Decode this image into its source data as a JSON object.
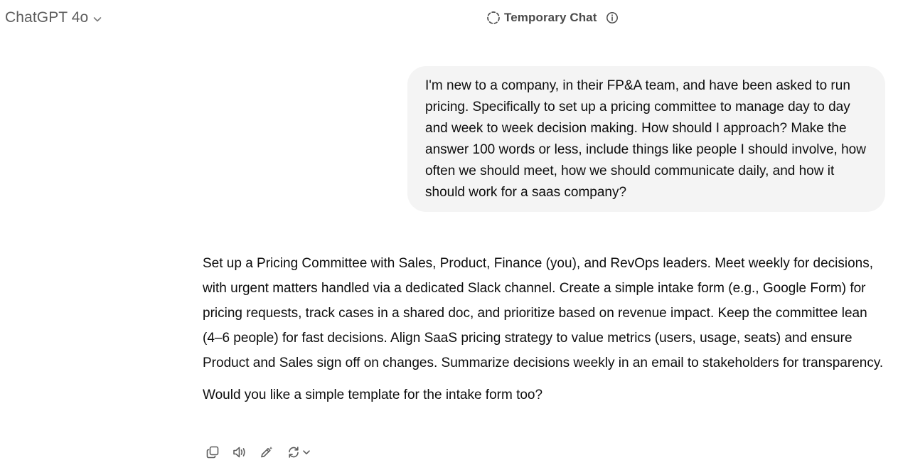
{
  "header": {
    "model_name": "ChatGPT 4o",
    "temporary_chat_label": "Temporary Chat"
  },
  "conversation": {
    "user_message": "I'm new to a company, in their FP&A team, and have been asked to run pricing. Specifically to set up a pricing committee to manage day to day and week to week decision making. How should I approach? Make the answer 100 words or less, include things like people I should involve, how often we should meet, how we should communicate daily, and how it should work for a saas company?",
    "assistant_paragraphs": [
      "Set up a Pricing Committee with Sales, Product, Finance (you), and RevOps leaders. Meet weekly for decisions, with urgent matters handled via a dedicated Slack channel. Create a simple intake form (e.g., Google Form) for pricing requests, track cases in a shared doc, and prioritize based on revenue impact. Keep the committee lean (4–6 people) for fast decisions. Align SaaS pricing strategy to value metrics (users, usage, seats) and ensure Product and Sales sign off on changes. Summarize decisions weekly in an email to stakeholders for transparency.",
      "Would you like a simple template for the intake form too?"
    ]
  },
  "actions": [
    {
      "icon": "copy-icon"
    },
    {
      "icon": "read-aloud-icon"
    },
    {
      "icon": "edit-in-canvas-icon"
    },
    {
      "icon": "regenerate-icon"
    }
  ],
  "colors": {
    "bubble_bg": "#f4f4f4",
    "icon_gray": "#5d5d5d",
    "text": "#0d0d0d"
  }
}
